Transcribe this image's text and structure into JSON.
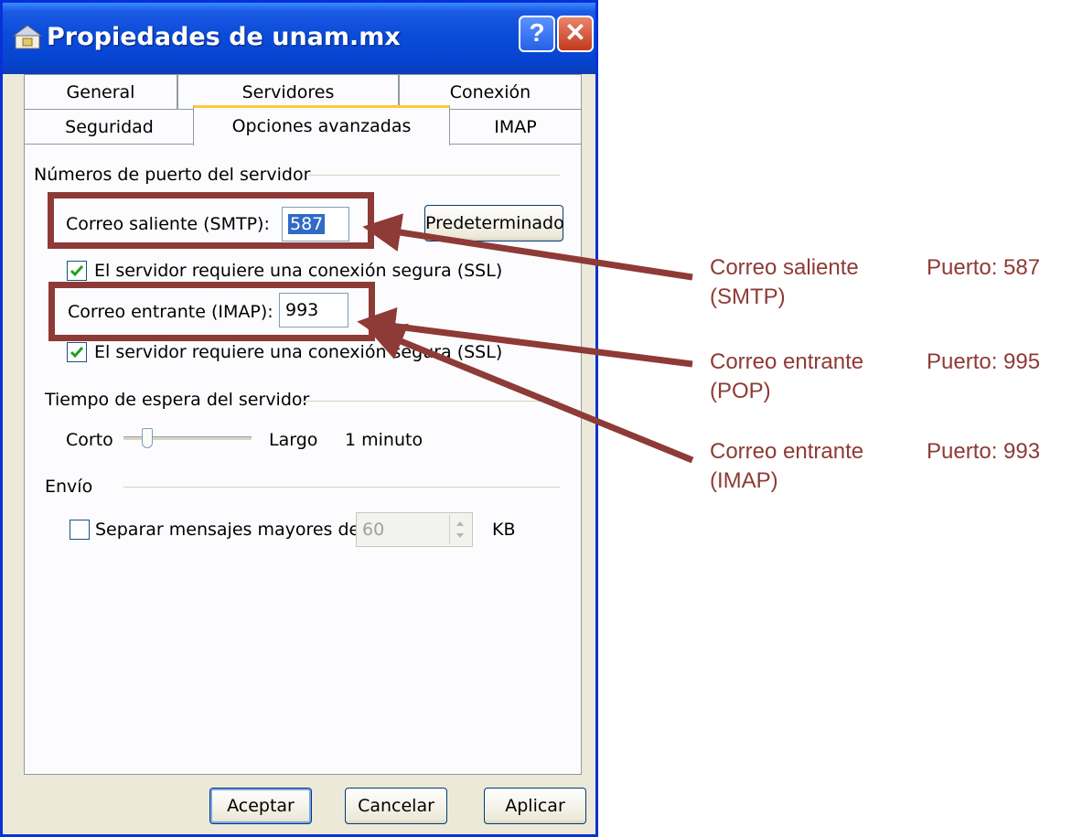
{
  "window": {
    "title": "Propiedades de unam.mx",
    "help_label": "?",
    "close_label": "✕"
  },
  "tabs": {
    "row_back": [
      "General",
      "Servidores",
      "Conexión"
    ],
    "row_front": [
      "Seguridad",
      "Opciones avanzadas",
      "IMAP"
    ],
    "active": "Opciones avanzadas"
  },
  "ports": {
    "group_label": "Números de puerto del servidor",
    "smtp_label": "Correo saliente (SMTP):",
    "smtp_value": "587",
    "default_button": "Predeterminado",
    "smtp_ssl_label": "El servidor requiere una conexión segura (SSL)",
    "smtp_ssl_checked": true,
    "imap_label": "Correo entrante (IMAP):",
    "imap_value": "993",
    "imap_ssl_label": "El servidor requiere una conexión segura (SSL)",
    "imap_ssl_checked": true
  },
  "timeout": {
    "group_label": "Tiempo de espera del servidor",
    "short_label": "Corto",
    "long_label": "Largo",
    "value_label": "1 minuto",
    "slider_fraction": 0.15
  },
  "sending": {
    "group_label": "Envío",
    "split_label": "Separar mensajes mayores de",
    "split_checked": false,
    "split_value": "60",
    "unit_label": "KB"
  },
  "buttons": {
    "ok": "Aceptar",
    "cancel": "Cancelar",
    "apply": "Aplicar"
  },
  "annotations": [
    {
      "service": "Correo saliente",
      "protocol": "(SMTP)",
      "port": "Puerto: 587"
    },
    {
      "service": "Correo entrante",
      "protocol": "(POP)",
      "port": "Puerto: 995"
    },
    {
      "service": "Correo entrante",
      "protocol": "(IMAP)",
      "port": "Puerto: 993"
    }
  ],
  "colors": {
    "annotation": "#8e3a36",
    "titlebar": "#0a4bd8",
    "tab_highlight": "#ffc83d"
  }
}
